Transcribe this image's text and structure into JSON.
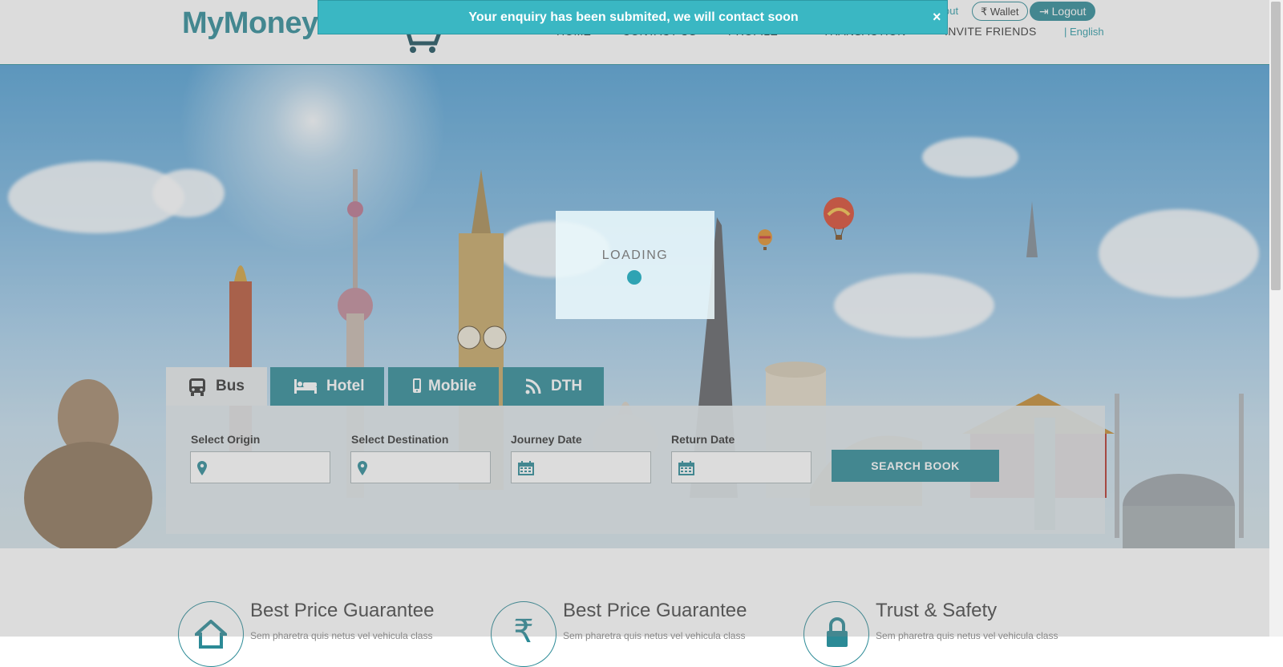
{
  "header": {
    "logo_text": "MyMoney",
    "nav": [
      "HOME",
      "CONTACT US",
      "PROFILE",
      "TRANSACTION",
      "INVITE FRIENDS"
    ],
    "language": "| English",
    "about_partial": "out",
    "wallet_label": "Wallet",
    "logout_label": "Logout"
  },
  "toast": {
    "message": "Your enquiry has been submited, we will contact soon",
    "close": "×"
  },
  "loading": {
    "label": "LOADING"
  },
  "search": {
    "tabs": [
      "Bus",
      "Hotel",
      "Mobile",
      "DTH"
    ],
    "active_tab": "Bus",
    "fields": {
      "origin_label": "Select Origin",
      "destination_label": "Select Destination",
      "journey_label": "Journey Date",
      "return_label": "Return Date",
      "origin_value": "",
      "destination_value": "",
      "journey_value": "",
      "return_value": ""
    },
    "button": "SEARCH BOOK"
  },
  "features": [
    {
      "title": "Best Price Guarantee",
      "text": "Sem pharetra quis netus vel vehicula class",
      "icon": "home-icon"
    },
    {
      "title": "Best Price Guarantee",
      "text": "Sem pharetra quis netus vel vehicula class",
      "icon": "rupee-icon"
    },
    {
      "title": "Trust & Safety",
      "text": "Sem pharetra quis netus vel vehicula class",
      "icon": "lock-icon"
    }
  ],
  "colors": {
    "brand": "#2b8a96",
    "toast": "#3ab7c3"
  }
}
